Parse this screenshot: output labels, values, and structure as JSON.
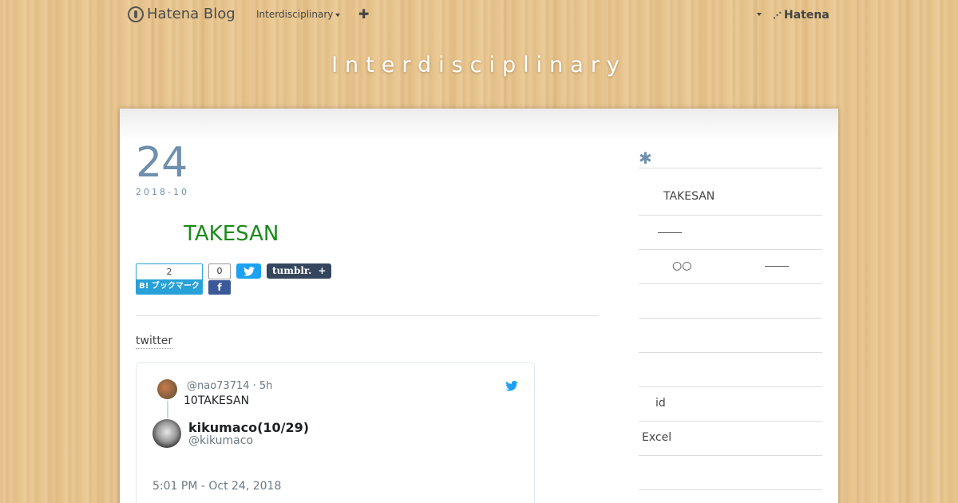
{
  "globalbar": {
    "logo_text": "Hatena Blog",
    "blog_menu": "Interdisciplinary",
    "plus_icon": "plus-icon",
    "hatena_text": "Hatena"
  },
  "blog": {
    "title": "Interdisciplinary"
  },
  "entry": {
    "day": "24",
    "year_month": "2018-10",
    "title": "TAKESAN",
    "share": {
      "hatena_count": "2",
      "hatena_label": "B! ブックマーク",
      "facebook_count": "0",
      "facebook_icon": "f",
      "tumblr_label": "tumblr.",
      "tumblr_plus": "+"
    },
    "section_label": "twitter",
    "tweet": {
      "reply_handle": "@nao73714 · 5h",
      "reply_text": "10TAKESAN",
      "author_name": "kikumaco(10/29)",
      "author_handle": "@kikumaco",
      "timestamp": "5:01 PM - Oct 24, 2018"
    }
  },
  "sidebar": {
    "star": "✱",
    "row1": "TAKESAN",
    "row3_symbol": "○○",
    "row6": "id",
    "row7": "Excel"
  },
  "colors": {
    "accent": "#6f8fae",
    "title_green": "#1a8a1a",
    "hatena_blue": "#28a0d8",
    "twitter_blue": "#1da1f2",
    "facebook_blue": "#3b5998",
    "tumblr_navy": "#35465c"
  }
}
